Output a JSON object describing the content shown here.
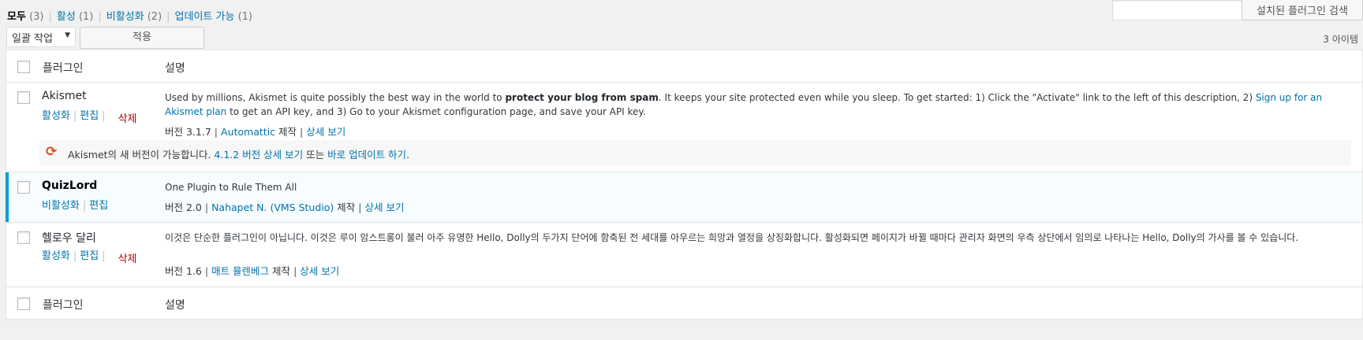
{
  "filters": {
    "all": {
      "label": "모두",
      "count": "(3)"
    },
    "active": {
      "label": "활성",
      "count": "(1)"
    },
    "inactive": {
      "label": "비활성화",
      "count": "(2)"
    },
    "upgrade": {
      "label": "업데이트 가능",
      "count": "(1)"
    }
  },
  "search": {
    "placeholder": "",
    "button": "설치된 플러그인 검색"
  },
  "bulk": {
    "selected": "일괄 작업",
    "apply": "적용"
  },
  "item_count": "3 아이템",
  "table": {
    "col_name": "플러그인",
    "col_desc": "설명"
  },
  "plugins": [
    {
      "name": "Akismet",
      "actions": [
        "활성화",
        "편집",
        "삭제"
      ],
      "desc_pre": "Used by millions, Akismet is quite possibly the best way in the world to ",
      "desc_bold": "protect your blog from spam",
      "desc_mid": ". It keeps your site protected even while you sleep. To get started: 1) Click the \"Activate\" link to the left of this description, 2) ",
      "desc_link": "Sign up for an Akismet plan",
      "desc_post": " to get an API key, and 3) Go to your Akismet configuration page, and save your API key.",
      "version": "버전 3.1.7",
      "author": "Automattic",
      "by": "제작",
      "details": "상세 보기",
      "update": {
        "pre": "Akismet의 새 버전이 가능합니다. ",
        "details_link": "4.1.2 버전 상세 보기",
        "mid": " 또는 ",
        "update_link": "바로 업데이트 하기",
        "post": "."
      }
    },
    {
      "name": "QuizLord",
      "actions": [
        "비활성화",
        "편집"
      ],
      "desc": "One Plugin to Rule Them All",
      "version": "버전 2.0",
      "author": "Nahapet N. (VMS Studio)",
      "by": "제작",
      "details": "상세 보기"
    },
    {
      "name": "헬로우 달리",
      "actions": [
        "활성화",
        "편집",
        "삭제"
      ],
      "desc": "이것은 단순한 플러그인이 아닙니다. 이것은 루이 암스트롱이 불러 아주 유명한 Hello, Dolly의 두가지 단어에 함축된 전 세대를 아우르는 희망과 열정을 상징화합니다. 활성화되면 페이지가 바뀔 때마다 관리자 화면의 우측 상단에서 임의로 나타나는 Hello, Dolly의 가사를 볼 수 있습니다.",
      "version": "버전 1.6",
      "author": "매트 뮬렌베그",
      "by": "제작",
      "details": "상세 보기"
    }
  ]
}
